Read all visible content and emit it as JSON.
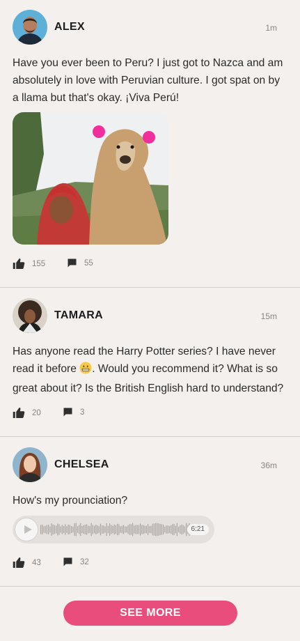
{
  "posts": [
    {
      "author": "ALEX",
      "time": "1m",
      "text": "Have you ever been to Peru? I just got to Nazca and am absolutely in love with Peruvian culture. I got spat on by a llama but that's okay. ¡Viva Perú!",
      "likes": "155",
      "comments": "55",
      "media": "photo"
    },
    {
      "author": "TAMARA",
      "time": "15m",
      "text_before_emoji": "Has anyone read the Harry Potter series? I have never read it before ",
      "emoji": "grimace-emoji",
      "text_after_emoji": ". Would you recommend it? What is so great about it? Is the British English hard to understand?",
      "likes": "20",
      "comments": "3"
    },
    {
      "author": "CHELSEA",
      "time": "36m",
      "text": "How's my prounciation?",
      "audio_duration": "6:21",
      "likes": "43",
      "comments": "32"
    }
  ],
  "see_more_label": "SEE MORE",
  "icons": {
    "like": "thumbs-up-icon",
    "comment": "comment-bubble-icon",
    "play": "play-icon"
  },
  "colors": {
    "accent": "#e84d7c",
    "background": "#f4f0ed"
  }
}
